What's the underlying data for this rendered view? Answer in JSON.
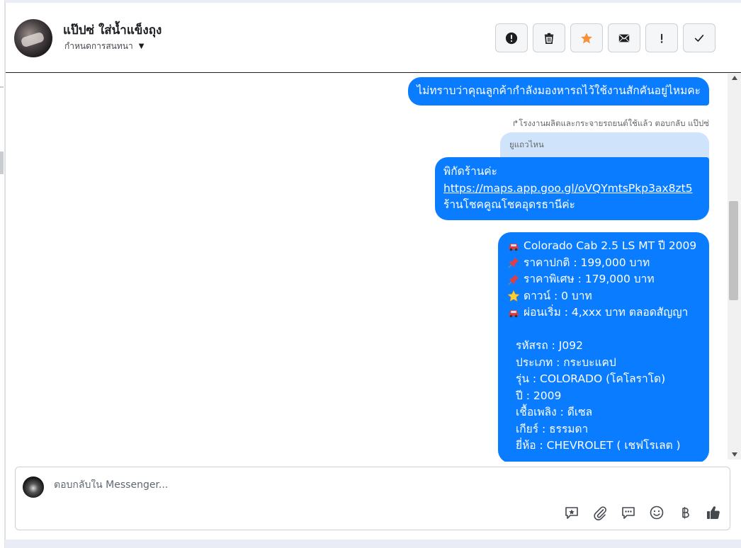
{
  "header": {
    "contact_name": "แป๊ปซ่ ใส่น้ำแข็งถุง",
    "assign_label": "กำหนดการสนทนา",
    "actions": [
      {
        "name": "report-spam",
        "icon": "alert-circle-icon"
      },
      {
        "name": "delete",
        "icon": "trash-icon"
      },
      {
        "name": "star",
        "icon": "star-icon"
      },
      {
        "name": "mark-unread",
        "icon": "envelope-icon"
      },
      {
        "name": "follow-up",
        "icon": "exclamation-icon"
      },
      {
        "name": "mark-done",
        "icon": "checkmark-icon"
      }
    ]
  },
  "messages": {
    "m1_text": "ไม่ทราบว่าคุณลูกค้ากำลังมองหารถไว้ใช้งานสักคันอยู่ไหมคะ",
    "reply_note": "โรงงานผลิตและกระจายรถยนต์ใช้แล้ว ตอบกลับ แป๊ปซ่",
    "quoted_text": "ยูแถวไหน",
    "m2_line1": "พิกัดร้านค่ะ",
    "m2_link": "https://maps.app.goo.gl/oVQYmtsPkp3ax8zt5",
    "m2_line3": "ร้านโชคคูณโชคอุดรธานีค่ะ",
    "m3": {
      "title": "Colorado Cab 2.5 LS MT ปี 2009",
      "normal_price": "ราคาปกติ : 199,000 บาท",
      "special_price": "ราคาพิเศษ : 179,000 บาท",
      "down": "ดาวน์ : 0 บาท",
      "installment": "ผ่อนเริ่ม : 4,xxx บาท ตลอดสัญญา",
      "code": "รหัสรถ : J092",
      "type": "ประเภท : กระบะแคป",
      "model": "รุ่น : COLORADO (โคโลราโด)",
      "year": "ปี : 2009",
      "fuel": "เชื้อเพลิง : ดีเซล",
      "gear": "เกียร์ : ธรรมดา",
      "brand": "ยี่ห้อ : CHEVROLET ( เชฟโรเลต )"
    }
  },
  "composer": {
    "placeholder": "ตอบกลับใน Messenger...",
    "tools": [
      "saved-reply-icon",
      "attachment-icon",
      "quick-reply-icon",
      "emoji-icon",
      "baht-icon",
      "thumbs-up-icon"
    ]
  },
  "colors": {
    "bubble": "#0a7cff",
    "quoted_bg": "#cfe3fb",
    "star": "#f7923b"
  }
}
